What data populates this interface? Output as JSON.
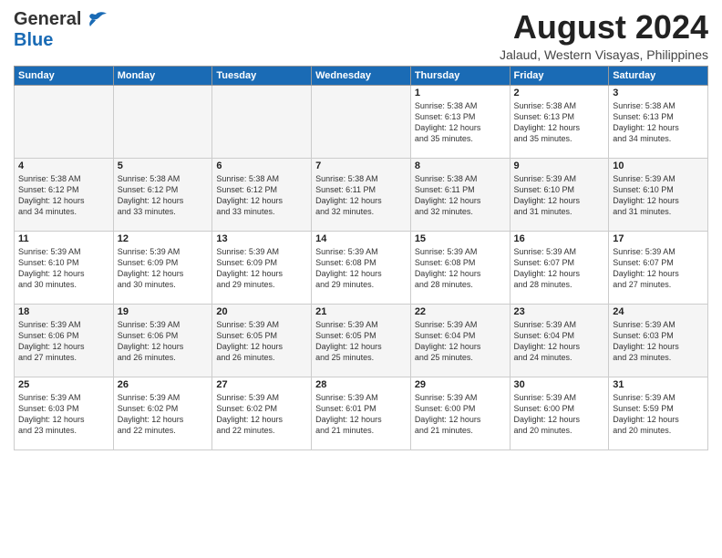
{
  "header": {
    "logo_line1": "General",
    "logo_line2": "Blue",
    "month_year": "August 2024",
    "location": "Jalaud, Western Visayas, Philippines"
  },
  "days_of_week": [
    "Sunday",
    "Monday",
    "Tuesday",
    "Wednesday",
    "Thursday",
    "Friday",
    "Saturday"
  ],
  "weeks": [
    [
      {
        "day": "",
        "info": "",
        "empty": true
      },
      {
        "day": "",
        "info": "",
        "empty": true
      },
      {
        "day": "",
        "info": "",
        "empty": true
      },
      {
        "day": "",
        "info": "",
        "empty": true
      },
      {
        "day": "1",
        "info": "Sunrise: 5:38 AM\nSunset: 6:13 PM\nDaylight: 12 hours\nand 35 minutes."
      },
      {
        "day": "2",
        "info": "Sunrise: 5:38 AM\nSunset: 6:13 PM\nDaylight: 12 hours\nand 35 minutes."
      },
      {
        "day": "3",
        "info": "Sunrise: 5:38 AM\nSunset: 6:13 PM\nDaylight: 12 hours\nand 34 minutes."
      }
    ],
    [
      {
        "day": "4",
        "info": "Sunrise: 5:38 AM\nSunset: 6:12 PM\nDaylight: 12 hours\nand 34 minutes."
      },
      {
        "day": "5",
        "info": "Sunrise: 5:38 AM\nSunset: 6:12 PM\nDaylight: 12 hours\nand 33 minutes."
      },
      {
        "day": "6",
        "info": "Sunrise: 5:38 AM\nSunset: 6:12 PM\nDaylight: 12 hours\nand 33 minutes."
      },
      {
        "day": "7",
        "info": "Sunrise: 5:38 AM\nSunset: 6:11 PM\nDaylight: 12 hours\nand 32 minutes."
      },
      {
        "day": "8",
        "info": "Sunrise: 5:38 AM\nSunset: 6:11 PM\nDaylight: 12 hours\nand 32 minutes."
      },
      {
        "day": "9",
        "info": "Sunrise: 5:39 AM\nSunset: 6:10 PM\nDaylight: 12 hours\nand 31 minutes."
      },
      {
        "day": "10",
        "info": "Sunrise: 5:39 AM\nSunset: 6:10 PM\nDaylight: 12 hours\nand 31 minutes."
      }
    ],
    [
      {
        "day": "11",
        "info": "Sunrise: 5:39 AM\nSunset: 6:10 PM\nDaylight: 12 hours\nand 30 minutes."
      },
      {
        "day": "12",
        "info": "Sunrise: 5:39 AM\nSunset: 6:09 PM\nDaylight: 12 hours\nand 30 minutes."
      },
      {
        "day": "13",
        "info": "Sunrise: 5:39 AM\nSunset: 6:09 PM\nDaylight: 12 hours\nand 29 minutes."
      },
      {
        "day": "14",
        "info": "Sunrise: 5:39 AM\nSunset: 6:08 PM\nDaylight: 12 hours\nand 29 minutes."
      },
      {
        "day": "15",
        "info": "Sunrise: 5:39 AM\nSunset: 6:08 PM\nDaylight: 12 hours\nand 28 minutes."
      },
      {
        "day": "16",
        "info": "Sunrise: 5:39 AM\nSunset: 6:07 PM\nDaylight: 12 hours\nand 28 minutes."
      },
      {
        "day": "17",
        "info": "Sunrise: 5:39 AM\nSunset: 6:07 PM\nDaylight: 12 hours\nand 27 minutes."
      }
    ],
    [
      {
        "day": "18",
        "info": "Sunrise: 5:39 AM\nSunset: 6:06 PM\nDaylight: 12 hours\nand 27 minutes."
      },
      {
        "day": "19",
        "info": "Sunrise: 5:39 AM\nSunset: 6:06 PM\nDaylight: 12 hours\nand 26 minutes."
      },
      {
        "day": "20",
        "info": "Sunrise: 5:39 AM\nSunset: 6:05 PM\nDaylight: 12 hours\nand 26 minutes."
      },
      {
        "day": "21",
        "info": "Sunrise: 5:39 AM\nSunset: 6:05 PM\nDaylight: 12 hours\nand 25 minutes."
      },
      {
        "day": "22",
        "info": "Sunrise: 5:39 AM\nSunset: 6:04 PM\nDaylight: 12 hours\nand 25 minutes."
      },
      {
        "day": "23",
        "info": "Sunrise: 5:39 AM\nSunset: 6:04 PM\nDaylight: 12 hours\nand 24 minutes."
      },
      {
        "day": "24",
        "info": "Sunrise: 5:39 AM\nSunset: 6:03 PM\nDaylight: 12 hours\nand 23 minutes."
      }
    ],
    [
      {
        "day": "25",
        "info": "Sunrise: 5:39 AM\nSunset: 6:03 PM\nDaylight: 12 hours\nand 23 minutes."
      },
      {
        "day": "26",
        "info": "Sunrise: 5:39 AM\nSunset: 6:02 PM\nDaylight: 12 hours\nand 22 minutes."
      },
      {
        "day": "27",
        "info": "Sunrise: 5:39 AM\nSunset: 6:02 PM\nDaylight: 12 hours\nand 22 minutes."
      },
      {
        "day": "28",
        "info": "Sunrise: 5:39 AM\nSunset: 6:01 PM\nDaylight: 12 hours\nand 21 minutes."
      },
      {
        "day": "29",
        "info": "Sunrise: 5:39 AM\nSunset: 6:00 PM\nDaylight: 12 hours\nand 21 minutes."
      },
      {
        "day": "30",
        "info": "Sunrise: 5:39 AM\nSunset: 6:00 PM\nDaylight: 12 hours\nand 20 minutes."
      },
      {
        "day": "31",
        "info": "Sunrise: 5:39 AM\nSunset: 5:59 PM\nDaylight: 12 hours\nand 20 minutes."
      }
    ]
  ]
}
